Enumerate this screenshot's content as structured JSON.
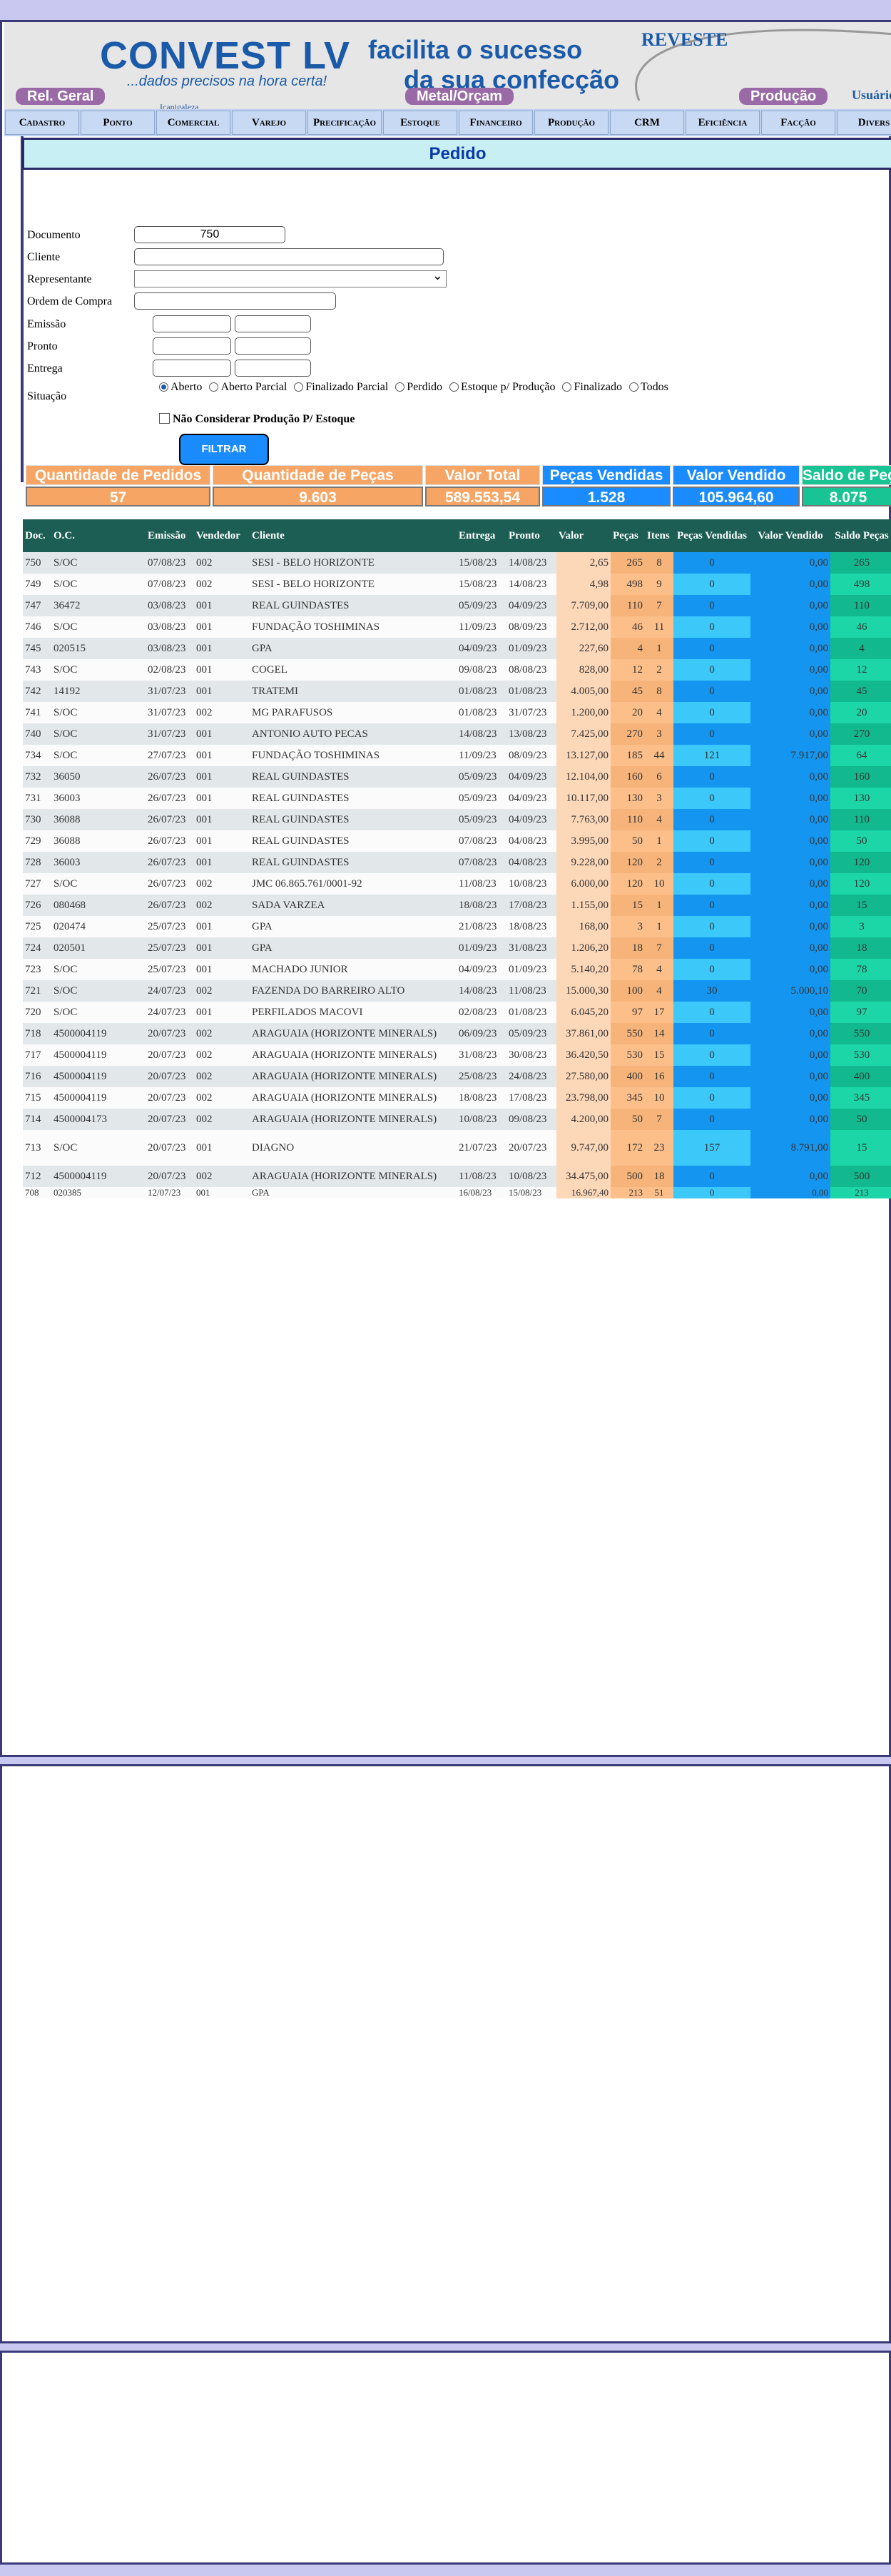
{
  "header": {
    "logo": "CONVEST LV",
    "logo_tagline": "...dados precisos na hora certa!",
    "slogan_line1": "facilita o sucesso",
    "slogan_line2": "da sua confecção",
    "brand_right": "REVESTE",
    "pills": [
      "Rel. Geral",
      "Metal/Orçam",
      "Produção"
    ],
    "user_label": "Usuário",
    "tiny_text": "Icanigaleza"
  },
  "nav": [
    "Cadastro",
    "Ponto",
    "Comercial",
    "Varejo",
    "Precificação",
    "Estoque",
    "Financeiro",
    "Produção",
    "CRM",
    "Eficiência",
    "Facção",
    "Divers"
  ],
  "page_title": "Pedido",
  "form": {
    "documento_label": "Documento",
    "documento_value": "750",
    "cliente_label": "Cliente",
    "cliente_value": "",
    "representante_label": "Representante",
    "representante_value": "",
    "ordem_label": "Ordem de Compra",
    "ordem_value": "",
    "emissao_label": "Emissão",
    "pronto_label": "Pronto",
    "entrega_label": "Entrega",
    "situacao_label": "Situação",
    "situacao_options": [
      "Aberto",
      "Aberto Parcial",
      "Finalizado Parcial",
      "Perdido",
      "Estoque p/ Produção",
      "Finalizado",
      "Todos"
    ],
    "situacao_selected": "Aberto",
    "checkbox_label": "Não Considerar Produção P/ Estoque",
    "filter_button": "FILTRAR"
  },
  "colors": {
    "orange": "#f7a565",
    "blue": "#1a8cff",
    "green": "#18c493",
    "dark_green": "#1c5e54"
  },
  "summary": [
    {
      "label": "Quantidade de Pedidos",
      "value": "57",
      "color": "#f7a565"
    },
    {
      "label": "Quantidade de Peças",
      "value": "9.603",
      "color": "#f7a565"
    },
    {
      "label": "Valor Total",
      "value": "589.553,54",
      "color": "#f7a565"
    },
    {
      "label": "Peças Vendidas",
      "value": "1.528",
      "color": "#1a8cff"
    },
    {
      "label": "Valor Vendido",
      "value": "105.964,60",
      "color": "#1a8cff"
    },
    {
      "label": "Saldo de Peças",
      "value": "8.075",
      "color": "#18c493"
    }
  ],
  "table": {
    "headers": [
      "Doc.",
      "O.C.",
      "Emissão",
      "Vendedor",
      "Cliente",
      "Entrega",
      "Pronto",
      "Valor",
      "Peças",
      "Itens",
      "Peças Vendidas",
      "Valor Vendido",
      "Saldo Peças"
    ],
    "rows": [
      [
        "750",
        "S/OC",
        "07/08/23",
        "002",
        "SESI - BELO HORIZONTE",
        "15/08/23",
        "14/08/23",
        "2,65",
        "265",
        "8",
        "0",
        "0,00",
        "265"
      ],
      [
        "749",
        "S/OC",
        "07/08/23",
        "002",
        "SESI - BELO HORIZONTE",
        "15/08/23",
        "14/08/23",
        "4,98",
        "498",
        "9",
        "0",
        "0,00",
        "498"
      ],
      [
        "747",
        "36472",
        "03/08/23",
        "001",
        "REAL GUINDASTES",
        "05/09/23",
        "04/09/23",
        "7.709,00",
        "110",
        "7",
        "0",
        "0,00",
        "110"
      ],
      [
        "746",
        "S/OC",
        "03/08/23",
        "001",
        "FUNDAÇÃO TOSHIMINAS",
        "11/09/23",
        "08/09/23",
        "2.712,00",
        "46",
        "11",
        "0",
        "0,00",
        "46"
      ],
      [
        "745",
        "020515",
        "03/08/23",
        "001",
        "GPA",
        "04/09/23",
        "01/09/23",
        "227,60",
        "4",
        "1",
        "0",
        "0,00",
        "4"
      ],
      [
        "743",
        "S/OC",
        "02/08/23",
        "001",
        "COGEL",
        "09/08/23",
        "08/08/23",
        "828,00",
        "12",
        "2",
        "0",
        "0,00",
        "12"
      ],
      [
        "742",
        "14192",
        "31/07/23",
        "001",
        "TRATEMI",
        "01/08/23",
        "01/08/23",
        "4.005,00",
        "45",
        "8",
        "0",
        "0,00",
        "45"
      ],
      [
        "741",
        "S/OC",
        "31/07/23",
        "002",
        "MG PARAFUSOS",
        "01/08/23",
        "31/07/23",
        "1.200,00",
        "20",
        "4",
        "0",
        "0,00",
        "20"
      ],
      [
        "740",
        "S/OC",
        "31/07/23",
        "001",
        "ANTONIO AUTO PECAS",
        "14/08/23",
        "13/08/23",
        "7.425,00",
        "270",
        "3",
        "0",
        "0,00",
        "270"
      ],
      [
        "734",
        "S/OC",
        "27/07/23",
        "001",
        "FUNDAÇÃO TOSHIMINAS",
        "11/09/23",
        "08/09/23",
        "13.127,00",
        "185",
        "44",
        "121",
        "7.917,00",
        "64"
      ],
      [
        "732",
        "36050",
        "26/07/23",
        "001",
        "REAL GUINDASTES",
        "05/09/23",
        "04/09/23",
        "12.104,00",
        "160",
        "6",
        "0",
        "0,00",
        "160"
      ],
      [
        "731",
        "36003",
        "26/07/23",
        "001",
        "REAL GUINDASTES",
        "05/09/23",
        "04/09/23",
        "10.117,00",
        "130",
        "3",
        "0",
        "0,00",
        "130"
      ],
      [
        "730",
        "36088",
        "26/07/23",
        "001",
        "REAL GUINDASTES",
        "05/09/23",
        "04/09/23",
        "7.763,00",
        "110",
        "4",
        "0",
        "0,00",
        "110"
      ],
      [
        "729",
        "36088",
        "26/07/23",
        "001",
        "REAL GUINDASTES",
        "07/08/23",
        "04/08/23",
        "3.995,00",
        "50",
        "1",
        "0",
        "0,00",
        "50"
      ],
      [
        "728",
        "36003",
        "26/07/23",
        "001",
        "REAL GUINDASTES",
        "07/08/23",
        "04/08/23",
        "9.228,00",
        "120",
        "2",
        "0",
        "0,00",
        "120"
      ],
      [
        "727",
        "S/OC",
        "26/07/23",
        "002",
        "JMC 06.865.761/0001-92",
        "11/08/23",
        "10/08/23",
        "6.000,00",
        "120",
        "10",
        "0",
        "0,00",
        "120"
      ],
      [
        "726",
        "080468",
        "26/07/23",
        "002",
        "SADA VARZEA",
        "18/08/23",
        "17/08/23",
        "1.155,00",
        "15",
        "1",
        "0",
        "0,00",
        "15"
      ],
      [
        "725",
        "020474",
        "25/07/23",
        "001",
        "GPA",
        "21/08/23",
        "18/08/23",
        "168,00",
        "3",
        "1",
        "0",
        "0,00",
        "3"
      ],
      [
        "724",
        "020501",
        "25/07/23",
        "001",
        "GPA",
        "01/09/23",
        "31/08/23",
        "1.206,20",
        "18",
        "7",
        "0",
        "0,00",
        "18"
      ],
      [
        "723",
        "S/OC",
        "25/07/23",
        "001",
        "MACHADO JUNIOR",
        "04/09/23",
        "01/09/23",
        "5.140,20",
        "78",
        "4",
        "0",
        "0,00",
        "78"
      ],
      [
        "721",
        "S/OC",
        "24/07/23",
        "002",
        "FAZENDA DO BARREIRO ALTO",
        "14/08/23",
        "11/08/23",
        "15.000,30",
        "100",
        "4",
        "30",
        "5.000,10",
        "70"
      ],
      [
        "720",
        "S/OC",
        "24/07/23",
        "001",
        "PERFILADOS MACOVI",
        "02/08/23",
        "01/08/23",
        "6.045,20",
        "97",
        "17",
        "0",
        "0,00",
        "97"
      ],
      [
        "718",
        "4500004119",
        "20/07/23",
        "002",
        "ARAGUAIA (HORIZONTE MINERALS)",
        "06/09/23",
        "05/09/23",
        "37.861,00",
        "550",
        "14",
        "0",
        "0,00",
        "550"
      ],
      [
        "717",
        "4500004119",
        "20/07/23",
        "002",
        "ARAGUAIA (HORIZONTE MINERALS)",
        "31/08/23",
        "30/08/23",
        "36.420,50",
        "530",
        "15",
        "0",
        "0,00",
        "530"
      ],
      [
        "716",
        "4500004119",
        "20/07/23",
        "002",
        "ARAGUAIA (HORIZONTE MINERALS)",
        "25/08/23",
        "24/08/23",
        "27.580,00",
        "400",
        "16",
        "0",
        "0,00",
        "400"
      ],
      [
        "715",
        "4500004119",
        "20/07/23",
        "002",
        "ARAGUAIA (HORIZONTE MINERALS)",
        "18/08/23",
        "17/08/23",
        "23.798,00",
        "345",
        "10",
        "0",
        "0,00",
        "345"
      ],
      [
        "714",
        "4500004173",
        "20/07/23",
        "002",
        "ARAGUAIA (HORIZONTE MINERALS)",
        "10/08/23",
        "09/08/23",
        "4.200,00",
        "50",
        "7",
        "0",
        "0,00",
        "50"
      ],
      [
        "713",
        "S/OC",
        "20/07/23",
        "001",
        "DIAGNO",
        "21/07/23",
        "20/07/23",
        "9.747,00",
        "172",
        "23",
        "157",
        "8.791,00",
        "15"
      ],
      [
        "712",
        "4500004119",
        "20/07/23",
        "002",
        "ARAGUAIA (HORIZONTE MINERALS)",
        "11/08/23",
        "10/08/23",
        "34.475,00",
        "500",
        "18",
        "0",
        "0,00",
        "500"
      ],
      [
        "708",
        "020385",
        "12/07/23",
        "001",
        "GPA",
        "16/08/23",
        "15/08/23",
        "16.967,40",
        "213",
        "51",
        "0",
        "0,00",
        "213"
      ]
    ]
  }
}
